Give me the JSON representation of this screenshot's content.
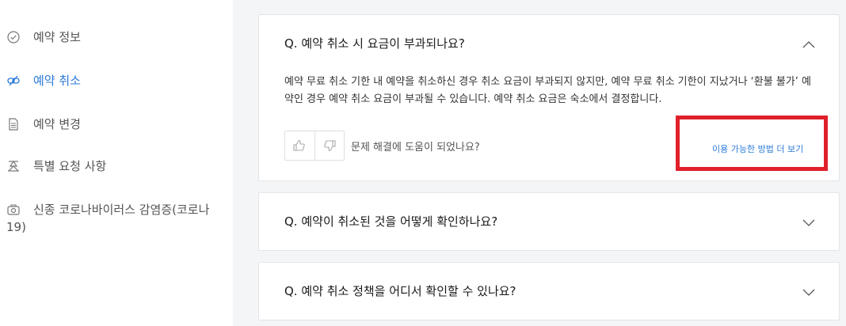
{
  "sidebar": {
    "items": [
      {
        "label": "예약 정보",
        "icon": "check-circle-icon",
        "active": false
      },
      {
        "label": "예약 취소",
        "icon": "cancel-link-icon",
        "active": true
      },
      {
        "label": "예약 변경",
        "icon": "document-icon",
        "active": false
      },
      {
        "label": "특별 요청 사항",
        "icon": "special-request-icon",
        "active": false
      },
      {
        "label": "신종 코로나바이러스 감염증(코로나 19)",
        "icon": "camera-icon",
        "active": false
      }
    ]
  },
  "faq": {
    "items": [
      {
        "question": "Q. 예약 취소 시 요금이 부과되나요?",
        "expanded": true,
        "answer": "예약 무료 취소 기한 내 예약을 취소하신 경우 취소 요금이 부과되지 않지만, 예약 무료 취소 기한이 지났거나 ‘환불 불가’ 예약인 경우 예약 취소 요금이 부과될 수 있습니다. 예약 취소 요금은 숙소에서 결정합니다.",
        "helpful_prompt": "문제 해결에 도움이 되었나요?",
        "more_link": "이용 가능한 방법 더 보기"
      },
      {
        "question": "Q. 예약이 취소된 것을 어떻게 확인하나요?",
        "expanded": false
      },
      {
        "question": "Q. 예약 취소 정책을 어디서 확인할 수 있나요?",
        "expanded": false
      }
    ]
  },
  "colors": {
    "accent": "#2b7bd8",
    "highlight": "#e0202a",
    "background": "#f4f5f7"
  }
}
